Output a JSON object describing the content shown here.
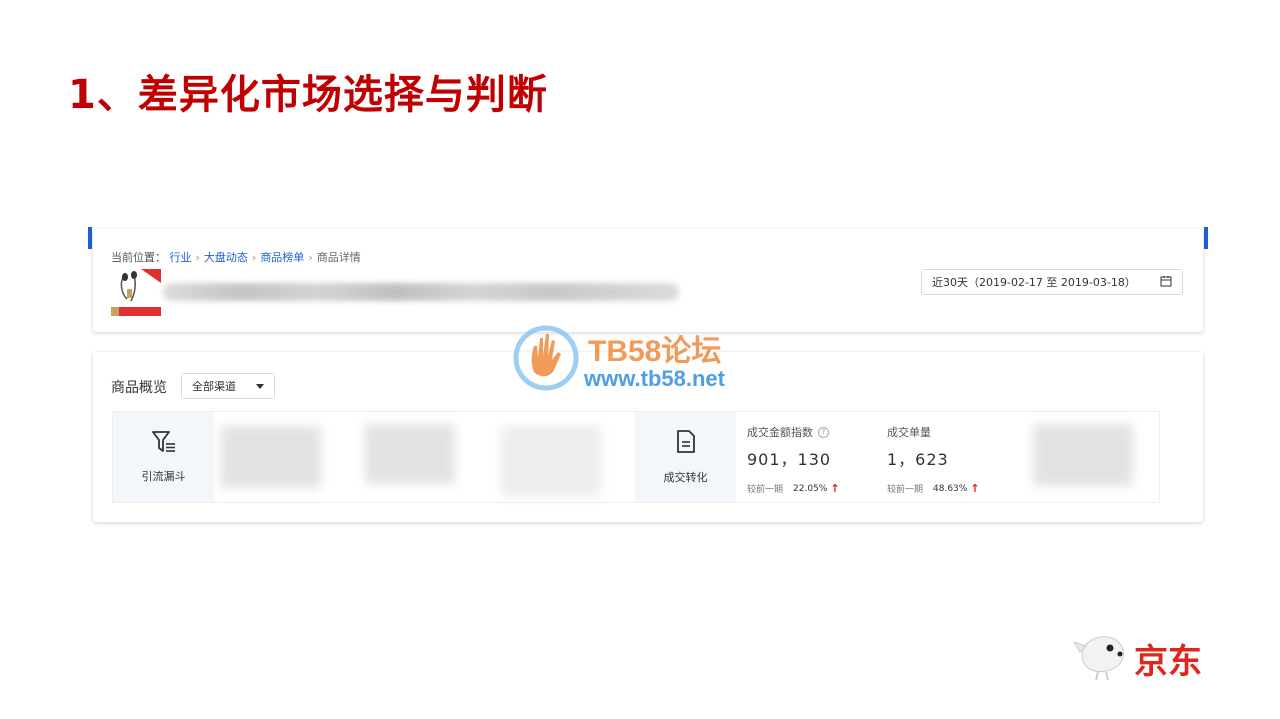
{
  "slide": {
    "title": "1、差异化市场选择与判断"
  },
  "breadcrumb": {
    "prefix": "当前位置：",
    "items": [
      "行业",
      "大盘动态",
      "商品榜单",
      "商品详情"
    ]
  },
  "date_range": {
    "label": "近30天（2019-02-17 至 2019-03-18）",
    "icon": "calendar-icon"
  },
  "overview": {
    "title": "商品概览",
    "channel_select": {
      "selected": "全部渠道"
    },
    "tabs": [
      {
        "label": "引流漏斗",
        "icon": "funnel-filter-icon"
      },
      {
        "label": "成交转化",
        "icon": "document-icon"
      }
    ],
    "metrics": [
      {
        "label": "成交金额指数",
        "value": "901，130",
        "compare_label": "较前一期",
        "compare_value": "22.05%",
        "trend": "up"
      },
      {
        "label": "成交单量",
        "value": "1，623",
        "compare_label": "较前一期",
        "compare_value": "48.63%",
        "trend": "up"
      }
    ]
  },
  "watermark": {
    "title": "TB58论坛",
    "url": "www.tb58.net"
  },
  "logo": {
    "text": "京东"
  },
  "colors": {
    "accent": "#1e5fd1",
    "title_red": "#c00000",
    "up_arrow": "#e02020",
    "logo_red": "#e1251b"
  }
}
